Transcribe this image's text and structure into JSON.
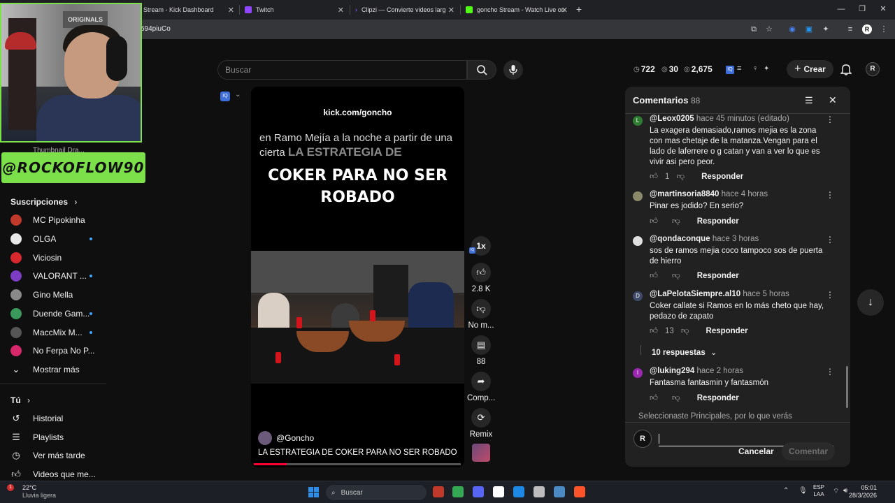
{
  "browser": {
    "tabs": [
      {
        "label": "Stream - Kick Dashboard",
        "color": "#53fc18"
      },
      {
        "label": "Twitch",
        "color": "#9146ff"
      },
      {
        "label": "Clipzi — Convierte videos larg",
        "color": "#7c4dff"
      },
      {
        "label": "goncho Stream - Watch Live on",
        "color": "#53fc18"
      }
    ],
    "new_tab_icon": "plus-icon",
    "url": "594piuCo",
    "window_controls": [
      "minimize-icon",
      "restore-icon",
      "close-icon"
    ]
  },
  "overlay": {
    "webcam_sign": "ORIGINALS",
    "banner_text": "@ROCKOFLOW90",
    "under_text": "Thumbnail Dra..."
  },
  "header": {
    "search_placeholder": "Buscar",
    "stats": [
      {
        "icon": "clock-icon",
        "value": "722"
      },
      {
        "icon": "eye-icon",
        "value": "30"
      },
      {
        "icon": "eye-outline-icon",
        "value": "2,675"
      }
    ],
    "create_label": "Crear"
  },
  "sidebar": {
    "subs_heading": "Suscripciones",
    "subs": [
      {
        "label": "MC Pipokinha",
        "color": "#c0392b",
        "dot": false
      },
      {
        "label": "OLGA",
        "color": "#e8e8e8",
        "dot": true
      },
      {
        "label": "Viciosin",
        "color": "#d6282d",
        "dot": false
      },
      {
        "label": "VALORANT ...",
        "color": "#7d3cc4",
        "dot": true
      },
      {
        "label": "Gino Mella",
        "color": "#8a8a8a",
        "dot": false
      },
      {
        "label": "Duende Gam...",
        "color": "#3a9a5c",
        "dot": true
      },
      {
        "label": "MaccMix M...",
        "color": "#555555",
        "dot": true
      },
      {
        "label": "No Ferpa No P...",
        "color": "#d6286a",
        "dot": false
      }
    ],
    "show_more": "Mostrar más",
    "you_heading": "Tú",
    "you_items": [
      {
        "label": "Historial",
        "icon": "history-icon"
      },
      {
        "label": "Playlists",
        "icon": "playlist-icon"
      },
      {
        "label": "Ver más tarde",
        "icon": "clock-icon"
      },
      {
        "label": "Videos que me...",
        "icon": "like-icon"
      }
    ]
  },
  "short": {
    "url_overlay": "kick.com/goncho",
    "caption_top": "en Ramo Mejía a la noche a partir de una cierta",
    "caption_overlay": "LA ESTRATEGIA DE",
    "title_line1": "COKER PARA NO SER",
    "title_line2": "ROBADO",
    "channel": "@Goncho",
    "description": "LA ESTRATEGIA DE COKER PARA NO SER ROBADO",
    "progress_fraction": 0.16,
    "actions": {
      "speed": "1x",
      "likes": "2.8 K",
      "dislike_label": "No m...",
      "comments": "88",
      "share_label": "Comp...",
      "remix_label": "Remix"
    }
  },
  "comments": {
    "title": "Comentarios",
    "count": "88",
    "items": [
      {
        "initial": "L",
        "avatar_color": "#2e7d32",
        "author": "@Leox0205",
        "time": "hace 45 minutos (editado)",
        "text": "La exagera demasiado,ramos mejia es la zona con mas chetaje de la matanza.Vengan para el lado de laferrere o g catan y van a ver lo que es vivir asi pero peor.",
        "likes": "1",
        "reply": "Responder"
      },
      {
        "initial": "",
        "avatar_color": "#8a8a6a",
        "author": "@martinsoria8840",
        "time": "hace 4 horas",
        "text": "Pinar es jodido? En serio?",
        "likes": "",
        "reply": "Responder"
      },
      {
        "initial": "",
        "avatar_color": "#e0e0e0",
        "author": "@qondaconque",
        "time": "hace 3 horas",
        "text": "sos de ramos mejia coco tampoco sos de puerta de hierro",
        "likes": "",
        "reply": "Responder"
      },
      {
        "initial": "D",
        "avatar_color": "#3f4a6b",
        "author": "@LaPelotaSiempre.al10",
        "time": "hace 5 horas",
        "text": "Coker callate si Ramos en lo más cheto que hay, pedazo de zapato",
        "likes": "13",
        "reply": "Responder"
      },
      {
        "initial": "I",
        "avatar_color": "#9c27b0",
        "author": "@luking294",
        "time": "hace 2 horas",
        "text": "Fantasma fantasmin y fantasmón",
        "likes": "",
        "reply": "Responder"
      }
    ],
    "replies_toggle": "10 respuestas",
    "sort_note": "Seleccionaste Principales, por lo que verás",
    "cancel_label": "Cancelar",
    "submit_label": "Comentar"
  },
  "taskbar": {
    "temperature": "22°C",
    "weather": "Lluvia ligera",
    "search_placeholder": "Buscar",
    "lang_line1": "ESP",
    "lang_line2": "LAA",
    "time": "05:01",
    "date": "28/3/2026",
    "apps": [
      {
        "name": "windows-icon",
        "color": "#2f8dea"
      },
      {
        "name": "file-icon",
        "color": "#c0392b"
      },
      {
        "name": "chrome-icon",
        "color": "#34a853"
      },
      {
        "name": "discord-icon",
        "color": "#5865f2"
      },
      {
        "name": "capcut-icon",
        "color": "#ffffff"
      },
      {
        "name": "edge-icon",
        "color": "#1e88e5"
      },
      {
        "name": "obs-icon",
        "color": "#bdbdbd"
      },
      {
        "name": "steam-icon",
        "color": "#4b8ac2"
      },
      {
        "name": "brave-icon",
        "color": "#fb542b"
      }
    ]
  }
}
